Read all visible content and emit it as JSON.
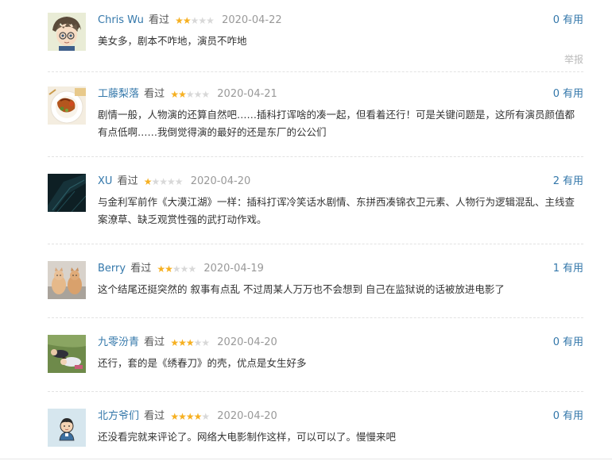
{
  "reviews": [
    {
      "username": "Chris Wu",
      "watched_label": "看过",
      "rating": 2,
      "date": "2020-04-22",
      "useful_count": "0",
      "useful_label": "有用",
      "content": "美女多，剧本不咋地，演员不咋地",
      "report_label": "举报",
      "avatar_icon": "anime-character-avatar-icon"
    },
    {
      "username": "工藤梨落",
      "watched_label": "看过",
      "rating": 2,
      "date": "2020-04-21",
      "useful_count": "0",
      "useful_label": "有用",
      "content": "剧情一般，人物演的还算自然吧……插科打诨啥的凑一起，但看着还行！可是关键问题是，这所有演员颜值都有点低啊……我倒觉得演的最好的还是东厂的公公们",
      "avatar_icon": "food-plate-avatar-icon"
    },
    {
      "username": "XU",
      "watched_label": "看过",
      "rating": 1,
      "date": "2020-04-20",
      "useful_count": "2",
      "useful_label": "有用",
      "content": "与金利军前作《大漠江湖》一样：插科打诨冷笑话水剧情、东拼西凑锦衣卫元素、人物行为逻辑混乱、主线查案潦草、缺乏观赏性强的武打动作戏。",
      "avatar_icon": "dark-teal-avatar-icon"
    },
    {
      "username": "Berry",
      "watched_label": "看过",
      "rating": 2,
      "date": "2020-04-19",
      "useful_count": "1",
      "useful_label": "有用",
      "content": "这个结尾还挺突然的 叙事有点乱 不过周某人万万也不会想到 自己在监狱说的话被放进电影了",
      "avatar_icon": "cats-avatar-icon"
    },
    {
      "username": "九零汾青",
      "watched_label": "看过",
      "rating": 3,
      "date": "2020-04-20",
      "useful_count": "0",
      "useful_label": "有用",
      "content": "还行，套的是《绣春刀》的壳，优点是女生好多",
      "avatar_icon": "people-on-grass-avatar-icon"
    },
    {
      "username": "北方爷们",
      "watched_label": "看过",
      "rating": 4,
      "date": "2020-04-20",
      "useful_count": "0",
      "useful_label": "有用",
      "content": "还没看完就来评论了。网络大电影制作这样，可以可以了。慢慢来吧",
      "avatar_icon": "cartoon-boy-avatar-icon"
    }
  ],
  "colors": {
    "name": "#3377aa",
    "star_on": "#f6b021",
    "star_off": "#d8d8d8",
    "date": "#999999",
    "text": "#333333"
  }
}
